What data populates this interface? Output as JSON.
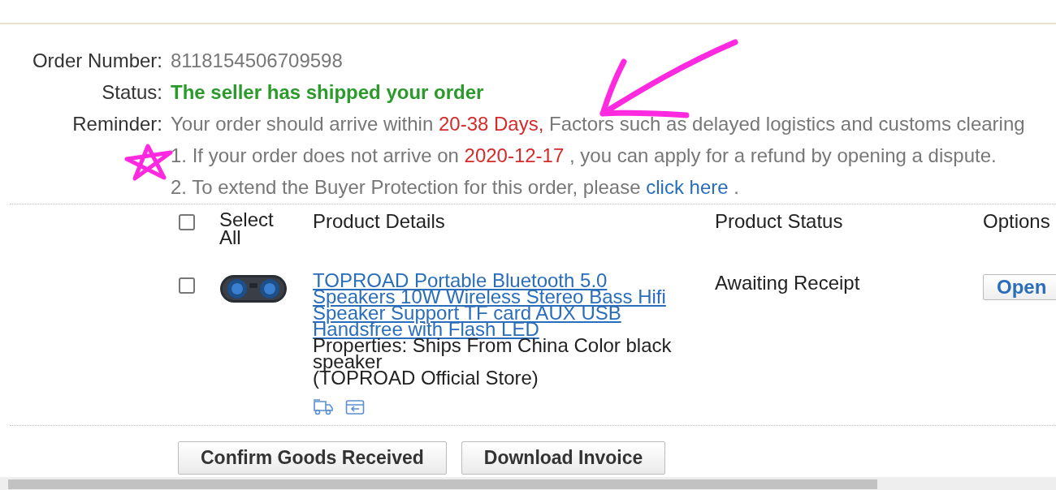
{
  "order_info": [
    {
      "kind": "plain",
      "label": "Order Number:",
      "parts": [
        {
          "kind": "text",
          "text": "8118154506709598"
        }
      ]
    },
    {
      "kind": "status",
      "label": "Status:",
      "parts": [
        {
          "kind": "text",
          "text": "The seller has shipped your order"
        }
      ]
    },
    {
      "kind": "plain",
      "label": "Reminder:",
      "parts": [
        {
          "kind": "text",
          "text": "Your order should arrive within "
        },
        {
          "kind": "highlight",
          "text": "20-38 Days,"
        },
        {
          "kind": "text",
          "text": " Factors such as delayed logistics and customs clearing"
        }
      ]
    },
    {
      "kind": "plain",
      "parts": [
        {
          "kind": "text",
          "text": "1. If your order does not arrive on "
        },
        {
          "kind": "highlight",
          "text": "2020-12-17"
        },
        {
          "kind": "text",
          "text": " , you can apply for a refund by opening a dispute."
        }
      ]
    },
    {
      "kind": "plain",
      "parts": [
        {
          "kind": "text",
          "text": "2. To extend the Buyer Protection for this order, please "
        },
        {
          "kind": "link",
          "text": "click here"
        },
        {
          "kind": "text",
          "text": " ."
        }
      ]
    }
  ],
  "table": {
    "select_all": {
      "label": "Select All",
      "checked": false
    },
    "columns": [
      "Product Details",
      "Product Status",
      "Options"
    ],
    "rows": [
      {
        "checked": false,
        "title": "TOPROAD Portable Bluetooth 5.0 Speakers 10W Wireless Stereo Bass Hifi Speaker Support TF card AUX USB Handsfree with Flash LED",
        "properties": "Properties: Ships From China Color black speaker",
        "store": "(TOPROAD Official Store)",
        "status": "Awaiting Receipt",
        "option": "Open"
      }
    ]
  },
  "buttons": [
    "Confirm Goods Received",
    "Download Invoice"
  ]
}
